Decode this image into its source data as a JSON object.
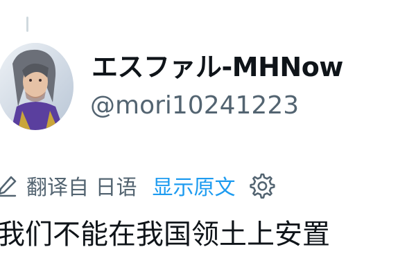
{
  "thread": {
    "connector": "thread-line"
  },
  "tweet": {
    "avatar_alt": "avatar",
    "display_name": "エスファル-MHNow",
    "handle": "@mori10241223",
    "translation": {
      "icon": "translate-icon",
      "label": "翻译自 日语",
      "show_original": "显示原文",
      "settings_icon": "gear-icon"
    },
    "text": "我们不能在我国领土上安置"
  },
  "colors": {
    "text_primary": "#0f1419",
    "text_secondary": "#536471",
    "link": "#1d9bf0",
    "thread_line": "#cfd9de"
  }
}
